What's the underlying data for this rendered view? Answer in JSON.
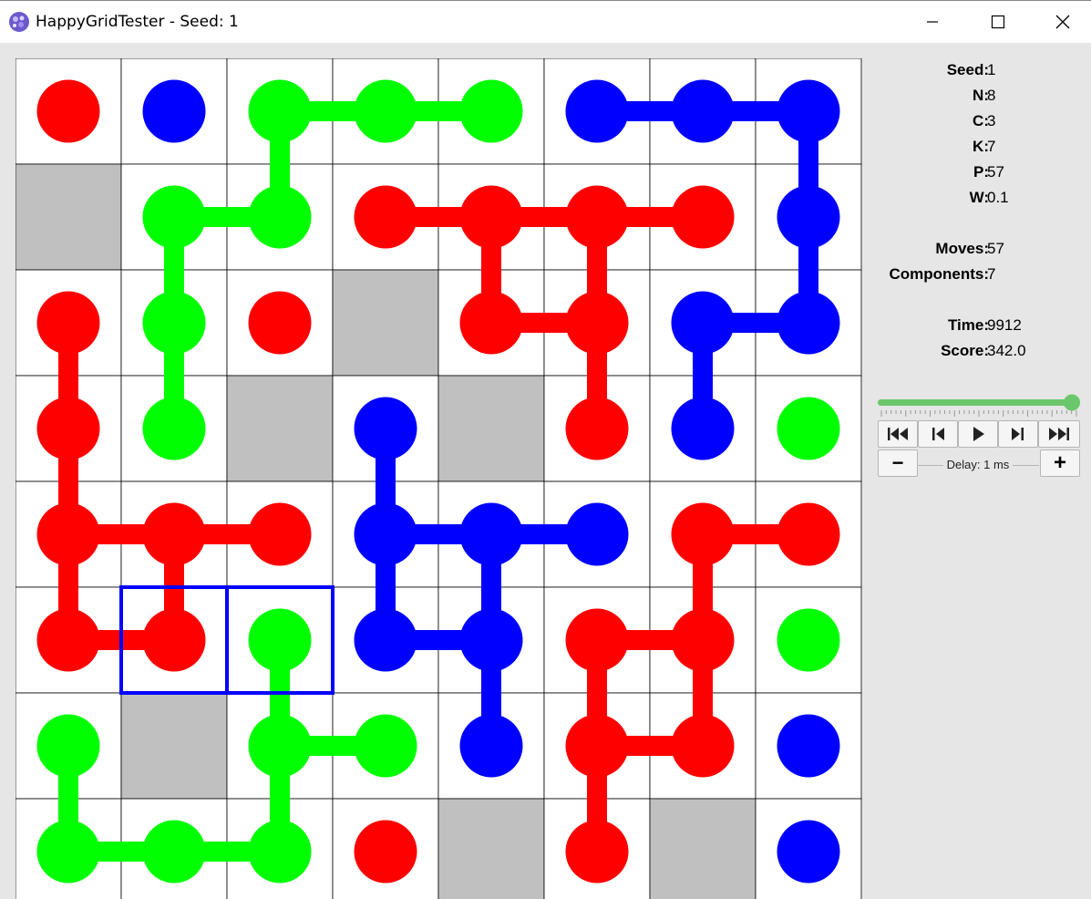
{
  "window": {
    "title": "HappyGridTester - Seed: 1"
  },
  "stats": [
    {
      "key": "Seed:",
      "value": "1"
    },
    {
      "key": "N:",
      "value": "8"
    },
    {
      "key": "C:",
      "value": "3"
    },
    {
      "key": "K:",
      "value": "7"
    },
    {
      "key": "P:",
      "value": "57"
    },
    {
      "key": "W:",
      "value": "0.1"
    },
    {
      "key": "Moves:",
      "value": "57"
    },
    {
      "key": "Components:",
      "value": "7"
    },
    {
      "key": "Time:",
      "value": "9912"
    },
    {
      "key": "Score:",
      "value": "342.0"
    }
  ],
  "playback": {
    "progress": 1.0,
    "buttons": [
      "first-icon",
      "prev-icon",
      "play-icon",
      "next-icon",
      "last-icon"
    ],
    "delay_label": "Delay: 1 ms",
    "decrease_label": "−",
    "increase_label": "+"
  },
  "colors": {
    "red": "#ff0000",
    "green": "#00ff00",
    "blue": "#0000ff",
    "wall": "#c0c0c0",
    "highlight": "#0000ff",
    "slider": "#6cc76c"
  },
  "board": {
    "n": 8,
    "grid": [
      "RB.GGGBBB",
      "#GG.RRRRB",
      "RGR#RR.BB",
      "RG#B#R.BG",
      "RRR.BBB.RR",
      "RR.GBB.RR.G",
      "G#GG.B.RR.B",
      "GGG.R#R#B"
    ],
    "cells": [
      [
        "R",
        "B",
        "G",
        "G",
        "G",
        "B",
        "B",
        "B"
      ],
      [
        "#",
        "G",
        "G",
        "R",
        "R",
        "R",
        "R",
        "B"
      ],
      [
        "R",
        "G",
        "R",
        "#",
        "R",
        "R",
        "B",
        "B"
      ],
      [
        "R",
        "G",
        "#",
        "B",
        "#",
        "R",
        "B",
        "G"
      ],
      [
        "R",
        "R",
        "R",
        "B",
        "B",
        "B",
        "R",
        "R"
      ],
      [
        "R",
        "R",
        "G",
        "B",
        "B",
        "R",
        "R",
        "G"
      ],
      [
        "G",
        "#",
        "G",
        "G",
        "B",
        "R",
        "R",
        "B"
      ],
      [
        "G",
        "G",
        "G",
        "R",
        "#",
        "R",
        "#",
        "B"
      ]
    ],
    "links": [
      [
        0,
        2,
        0,
        3
      ],
      [
        0,
        3,
        0,
        4
      ],
      [
        0,
        2,
        1,
        2
      ],
      [
        1,
        1,
        1,
        2
      ],
      [
        1,
        1,
        2,
        1
      ],
      [
        2,
        1,
        3,
        1
      ],
      [
        0,
        5,
        0,
        6
      ],
      [
        0,
        6,
        0,
        7
      ],
      [
        0,
        7,
        1,
        7
      ],
      [
        1,
        7,
        2,
        7
      ],
      [
        2,
        6,
        2,
        7
      ],
      [
        2,
        6,
        3,
        6
      ],
      [
        1,
        3,
        1,
        4
      ],
      [
        1,
        4,
        1,
        5
      ],
      [
        1,
        5,
        1,
        6
      ],
      [
        1,
        4,
        2,
        4
      ],
      [
        1,
        5,
        2,
        5
      ],
      [
        2,
        4,
        2,
        5
      ],
      [
        2,
        5,
        3,
        5
      ],
      [
        2,
        0,
        3,
        0
      ],
      [
        3,
        0,
        4,
        0
      ],
      [
        4,
        0,
        4,
        1
      ],
      [
        4,
        1,
        4,
        2
      ],
      [
        4,
        0,
        5,
        0
      ],
      [
        4,
        1,
        5,
        1
      ],
      [
        5,
        0,
        5,
        1
      ],
      [
        3,
        3,
        4,
        3
      ],
      [
        4,
        3,
        4,
        4
      ],
      [
        4,
        4,
        4,
        5
      ],
      [
        4,
        3,
        5,
        3
      ],
      [
        5,
        3,
        5,
        4
      ],
      [
        4,
        4,
        5,
        4
      ],
      [
        5,
        4,
        6,
        4
      ],
      [
        4,
        6,
        4,
        7
      ],
      [
        4,
        6,
        5,
        6
      ],
      [
        5,
        5,
        5,
        6
      ],
      [
        5,
        5,
        6,
        5
      ],
      [
        5,
        6,
        6,
        6
      ],
      [
        6,
        5,
        6,
        6
      ],
      [
        6,
        5,
        7,
        5
      ],
      [
        5,
        2,
        6,
        2
      ],
      [
        6,
        2,
        6,
        3
      ],
      [
        6,
        2,
        7,
        2
      ],
      [
        7,
        1,
        7,
        2
      ],
      [
        7,
        0,
        7,
        1
      ],
      [
        6,
        0,
        7,
        0
      ]
    ],
    "highlight": [
      [
        5,
        1
      ],
      [
        5,
        2
      ]
    ]
  }
}
